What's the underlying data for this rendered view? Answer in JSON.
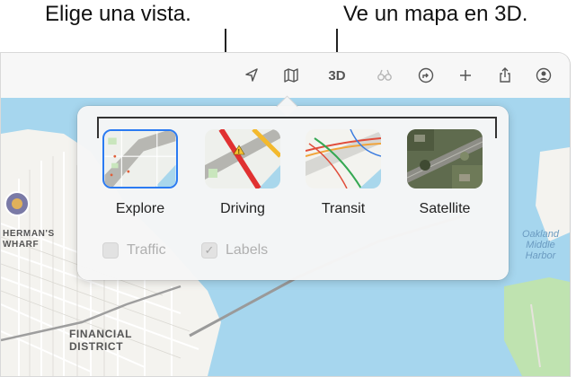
{
  "callouts": {
    "view": "Elige una vista.",
    "three_d": "Ve un mapa en 3D."
  },
  "toolbar": {
    "location_icon": "location-arrow-icon",
    "map_icon": "map-icon",
    "three_d_label": "3D",
    "lookaround_icon": "binoculars-icon",
    "directions_icon": "directions-icon",
    "add_icon": "plus-icon",
    "share_icon": "share-icon",
    "account_icon": "person-circle-icon"
  },
  "views": [
    {
      "label": "Explore",
      "selected": true
    },
    {
      "label": "Driving",
      "selected": false
    },
    {
      "label": "Transit",
      "selected": false
    },
    {
      "label": "Satellite",
      "selected": false
    }
  ],
  "options": {
    "traffic_label": "Traffic",
    "traffic_checked": false,
    "labels_label": "Labels",
    "labels_checked": true
  },
  "map_labels": {
    "wharf_line1": "HERMAN'S",
    "wharf_line2": "WHARF",
    "district_line1": "FINANCIAL",
    "district_line2": "DISTRICT",
    "harbor_line1": "Oakland",
    "harbor_line2": "Middle",
    "harbor_line3": "Harbor"
  },
  "colors": {
    "water": "#a6d6ee",
    "land": "#f4f3ef",
    "park": "#bfe3b0",
    "selection": "#2b7bf2"
  }
}
